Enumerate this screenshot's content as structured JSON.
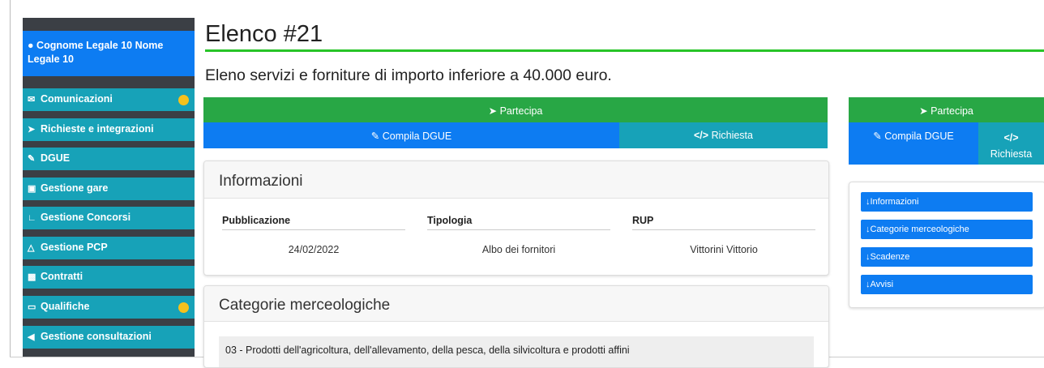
{
  "sidebar": {
    "user": {
      "icon": "user-circle-icon",
      "name": "Cognome Legale 10 Nome Legale 10"
    },
    "items": [
      {
        "icon": "envelope-icon",
        "label": "Comunicazioni",
        "badge": true
      },
      {
        "icon": "paper-plane-icon",
        "label": "Richieste e integrazioni",
        "badge": false
      },
      {
        "icon": "edit-icon",
        "label": "DGUE",
        "badge": false
      },
      {
        "icon": "briefcase-icon",
        "label": "Gestione gare",
        "badge": false
      },
      {
        "icon": "chair-icon",
        "label": "Gestione Concorsi",
        "badge": false
      },
      {
        "icon": "flask-icon",
        "label": "Gestione PCP",
        "badge": false
      },
      {
        "icon": "file-signature-icon",
        "label": "Contratti",
        "badge": false
      },
      {
        "icon": "folder-open-icon",
        "label": "Qualifiche",
        "badge": true
      },
      {
        "icon": "bullhorn-icon",
        "label": "Gestione consultazioni",
        "badge": false
      }
    ],
    "badge_color": "#f5c11c"
  },
  "page": {
    "title": "Elenco #21",
    "subtitle": "Eleno servizi e forniture di importo inferiore a 40.000 euro."
  },
  "actions": {
    "partecipa": "Partecipa",
    "compila_dgue": "Compila DGUE",
    "richiesta": "Richiesta"
  },
  "informazioni": {
    "header": "Informazioni",
    "columns": [
      "Pubblicazione",
      "Tipologia",
      "RUP"
    ],
    "values": [
      "24/02/2022",
      "Albo dei fornitori",
      "Vittorini Vittorio"
    ]
  },
  "categorie": {
    "header": "Categorie merceologiche",
    "items": [
      {
        "code": "03",
        "label": "Prodotti dell'agricoltura, dell'allevamento, della pesca, della silvicoltura e prodotti affini"
      }
    ]
  },
  "side_nav": [
    "Informazioni",
    "Categorie merceologiche",
    "Scadenze",
    "Avvisi"
  ],
  "colors": {
    "accent_green": "#28a745",
    "primary_blue": "#0d7cf2",
    "teal": "#17a2b8",
    "title_rule": "#28c428"
  }
}
